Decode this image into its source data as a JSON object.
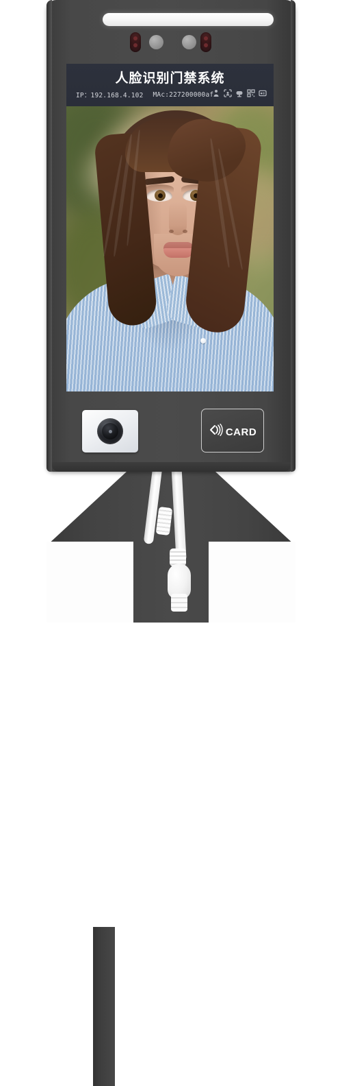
{
  "device": {
    "name": "face-recognition-access-terminal",
    "body_color": "#484848",
    "accent_color": "#ffffff"
  },
  "top_panel": {
    "light_bar_label": "fill-light-bar",
    "ir_led_left_label": "ir-led-left",
    "ir_led_right_label": "ir-led-right",
    "sensor_left_label": "ambient-sensor-left",
    "sensor_right_label": "ambient-sensor-right"
  },
  "screen": {
    "status_bar": {
      "title": "人脸识别门禁系统",
      "ip_label": "IP：192.168.4.102",
      "mac_label": "MAc:227200000af",
      "background_color": "#2a2e39",
      "icons": [
        {
          "name": "person-status-icon",
          "glyph": "person"
        },
        {
          "name": "face-detect-icon",
          "glyph": "face"
        },
        {
          "name": "network-icon",
          "glyph": "network"
        },
        {
          "name": "qr-code-icon",
          "glyph": "qr"
        },
        {
          "name": "card-status-icon",
          "glyph": "card"
        }
      ]
    },
    "preview": {
      "name": "live-camera-preview",
      "subject": "female-portrait",
      "background_tone": "#8e8a55",
      "shirt_color": "#9bb8d8",
      "hair_color": "#5a3a27"
    }
  },
  "hardware": {
    "camera_module_label": "camera-module",
    "card_reader": {
      "label": "CARD",
      "icon_name": "rfid-wave-icon",
      "border_color": "#cfcfcf"
    }
  },
  "mount": {
    "label": "wall-mount-bracket",
    "cable_label": "power-network-cable"
  }
}
